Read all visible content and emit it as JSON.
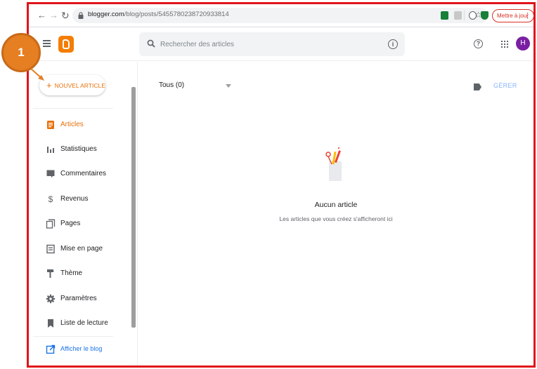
{
  "browser": {
    "url_host": "blogger.com",
    "url_path": "/blog/posts/5455780238720933814",
    "update_button": "Mettre à jour"
  },
  "header": {
    "search_placeholder": "Rechercher des articles",
    "avatar_letter": "H"
  },
  "sidebar": {
    "new_post": "NOUVEL ARTICLE",
    "items": [
      {
        "label": "Articles",
        "icon": "article-icon",
        "active": true
      },
      {
        "label": "Statistiques",
        "icon": "stats-icon"
      },
      {
        "label": "Commentaires",
        "icon": "comment-icon"
      },
      {
        "label": "Revenus",
        "icon": "dollar-icon"
      },
      {
        "label": "Pages",
        "icon": "pages-icon"
      },
      {
        "label": "Mise en page",
        "icon": "layout-icon"
      },
      {
        "label": "Thème",
        "icon": "paint-roller-icon"
      },
      {
        "label": "Paramètres",
        "icon": "gear-icon"
      },
      {
        "label": "Liste de lecture",
        "icon": "bookmark-icon"
      }
    ],
    "view_blog": "Afficher le blog"
  },
  "main": {
    "filter": "Tous (0)",
    "manage": "GÉRER",
    "empty_title": "Aucun article",
    "empty_subtitle": "Les articles que vous créez s'afficheront ici"
  },
  "annotation": {
    "step": "1"
  },
  "colors": {
    "accent": "#e8710a",
    "frame": "#e0141b",
    "badge": "#e67e22",
    "link": "#1a73e8"
  }
}
